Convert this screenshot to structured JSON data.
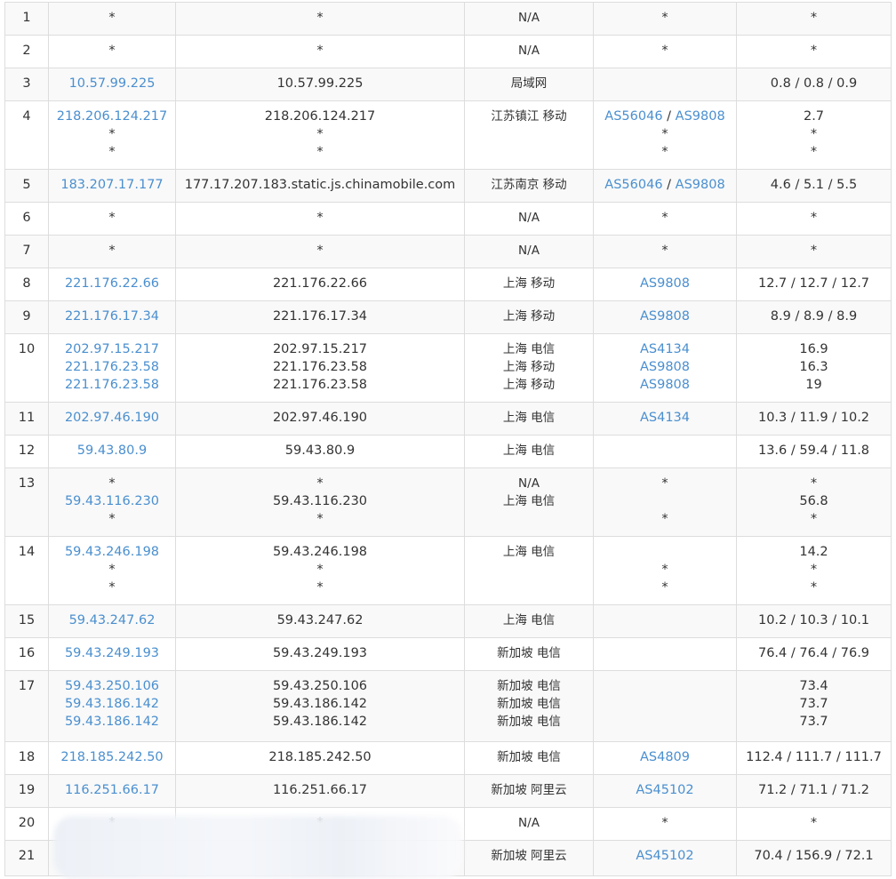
{
  "hops": [
    {
      "hop": "1",
      "ip": [
        "*"
      ],
      "host": [
        "*"
      ],
      "geo": [
        "N/A"
      ],
      "asn": [
        []
      ],
      "asn_star": [
        "*"
      ],
      "latency": [
        "*"
      ]
    },
    {
      "hop": "2",
      "ip": [
        "*"
      ],
      "host": [
        "*"
      ],
      "geo": [
        "N/A"
      ],
      "asn": [
        []
      ],
      "asn_star": [
        "*"
      ],
      "latency": [
        "*"
      ]
    },
    {
      "hop": "3",
      "ip": [
        "10.57.99.225"
      ],
      "host": [
        "10.57.99.225"
      ],
      "geo": [
        "局域网"
      ],
      "asn": [
        []
      ],
      "asn_star": [
        ""
      ],
      "latency": [
        "0.8 / 0.8 / 0.9"
      ]
    },
    {
      "hop": "4",
      "ip": [
        "218.206.124.217",
        "*",
        "*"
      ],
      "host": [
        "218.206.124.217",
        "*",
        "*"
      ],
      "geo": [
        "江苏镇江 移动",
        "",
        ""
      ],
      "asn": [
        [
          "AS56046",
          "AS9808"
        ],
        [],
        []
      ],
      "asn_star": [
        "",
        "*",
        "*"
      ],
      "latency": [
        "2.7",
        "*",
        "*"
      ]
    },
    {
      "hop": "5",
      "ip": [
        "183.207.17.177"
      ],
      "host": [
        "177.17.207.183.static.js.chinamobile.com"
      ],
      "geo": [
        "江苏南京 移动"
      ],
      "asn": [
        [
          "AS56046",
          "AS9808"
        ]
      ],
      "asn_star": [
        ""
      ],
      "latency": [
        "4.6 / 5.1 / 5.5"
      ]
    },
    {
      "hop": "6",
      "ip": [
        "*"
      ],
      "host": [
        "*"
      ],
      "geo": [
        "N/A"
      ],
      "asn": [
        []
      ],
      "asn_star": [
        "*"
      ],
      "latency": [
        "*"
      ]
    },
    {
      "hop": "7",
      "ip": [
        "*"
      ],
      "host": [
        "*"
      ],
      "geo": [
        "N/A"
      ],
      "asn": [
        []
      ],
      "asn_star": [
        "*"
      ],
      "latency": [
        "*"
      ]
    },
    {
      "hop": "8",
      "ip": [
        "221.176.22.66"
      ],
      "host": [
        "221.176.22.66"
      ],
      "geo": [
        "上海 移动"
      ],
      "asn": [
        [
          "AS9808"
        ]
      ],
      "asn_star": [
        ""
      ],
      "latency": [
        "12.7 / 12.7 / 12.7"
      ]
    },
    {
      "hop": "9",
      "ip": [
        "221.176.17.34"
      ],
      "host": [
        "221.176.17.34"
      ],
      "geo": [
        "上海 移动"
      ],
      "asn": [
        [
          "AS9808"
        ]
      ],
      "asn_star": [
        ""
      ],
      "latency": [
        "8.9 / 8.9 / 8.9"
      ]
    },
    {
      "hop": "10",
      "ip": [
        "202.97.15.217",
        "221.176.23.58",
        "221.176.23.58"
      ],
      "host": [
        "202.97.15.217",
        "221.176.23.58",
        "221.176.23.58"
      ],
      "geo": [
        "上海 电信",
        "上海 移动",
        "上海 移动"
      ],
      "asn": [
        [
          "AS4134"
        ],
        [
          "AS9808"
        ],
        [
          "AS9808"
        ]
      ],
      "asn_star": [
        "",
        "",
        ""
      ],
      "latency": [
        "16.9",
        "16.3",
        "19"
      ]
    },
    {
      "hop": "11",
      "ip": [
        "202.97.46.190"
      ],
      "host": [
        "202.97.46.190"
      ],
      "geo": [
        "上海 电信"
      ],
      "asn": [
        [
          "AS4134"
        ]
      ],
      "asn_star": [
        ""
      ],
      "latency": [
        "10.3 / 11.9 / 10.2"
      ]
    },
    {
      "hop": "12",
      "ip": [
        "59.43.80.9"
      ],
      "host": [
        "59.43.80.9"
      ],
      "geo": [
        "上海 电信"
      ],
      "asn": [
        []
      ],
      "asn_star": [
        ""
      ],
      "latency": [
        "13.6 / 59.4 / 11.8"
      ]
    },
    {
      "hop": "13",
      "ip": [
        "*",
        "59.43.116.230",
        "*"
      ],
      "host": [
        "*",
        "59.43.116.230",
        "*"
      ],
      "geo": [
        "N/A",
        "上海 电信",
        ""
      ],
      "asn": [
        [],
        [],
        []
      ],
      "asn_star": [
        "*",
        "",
        "*"
      ],
      "latency": [
        "*",
        "56.8",
        "*"
      ]
    },
    {
      "hop": "14",
      "ip": [
        "59.43.246.198",
        "*",
        "*"
      ],
      "host": [
        "59.43.246.198",
        "*",
        "*"
      ],
      "geo": [
        "上海 电信",
        "",
        ""
      ],
      "asn": [
        [],
        [],
        []
      ],
      "asn_star": [
        "",
        "*",
        "*"
      ],
      "latency": [
        "14.2",
        "*",
        "*"
      ]
    },
    {
      "hop": "15",
      "ip": [
        "59.43.247.62"
      ],
      "host": [
        "59.43.247.62"
      ],
      "geo": [
        "上海 电信"
      ],
      "asn": [
        []
      ],
      "asn_star": [
        ""
      ],
      "latency": [
        "10.2 / 10.3 / 10.1"
      ]
    },
    {
      "hop": "16",
      "ip": [
        "59.43.249.193"
      ],
      "host": [
        "59.43.249.193"
      ],
      "geo": [
        "新加坡 电信"
      ],
      "asn": [
        []
      ],
      "asn_star": [
        ""
      ],
      "latency": [
        "76.4 / 76.4 / 76.9"
      ]
    },
    {
      "hop": "17",
      "ip": [
        "59.43.250.106",
        "59.43.186.142",
        "59.43.186.142"
      ],
      "host": [
        "59.43.250.106",
        "59.43.186.142",
        "59.43.186.142"
      ],
      "geo": [
        "新加坡 电信",
        "新加坡 电信",
        "新加坡 电信"
      ],
      "asn": [
        [],
        [],
        []
      ],
      "asn_star": [
        "",
        "",
        ""
      ],
      "latency": [
        "73.4",
        "73.7",
        "73.7"
      ]
    },
    {
      "hop": "18",
      "ip": [
        "218.185.242.50"
      ],
      "host": [
        "218.185.242.50"
      ],
      "geo": [
        "新加坡 电信"
      ],
      "asn": [
        [
          "AS4809"
        ]
      ],
      "asn_star": [
        ""
      ],
      "latency": [
        "112.4 / 111.7 / 111.7"
      ]
    },
    {
      "hop": "19",
      "ip": [
        "116.251.66.17"
      ],
      "host": [
        "116.251.66.17"
      ],
      "geo": [
        "新加坡 阿里云"
      ],
      "asn": [
        [
          "AS45102"
        ]
      ],
      "asn_star": [
        ""
      ],
      "latency": [
        "71.2 / 71.1 / 71.2"
      ]
    },
    {
      "hop": "20",
      "ip": [
        "*"
      ],
      "host": [
        "*"
      ],
      "geo": [
        "N/A"
      ],
      "asn": [
        []
      ],
      "asn_star": [
        "*"
      ],
      "latency": [
        "*"
      ]
    },
    {
      "hop": "21",
      "ip": [
        ""
      ],
      "host": [
        ""
      ],
      "geo": [
        "新加坡 阿里云"
      ],
      "asn": [
        [
          "AS45102"
        ]
      ],
      "asn_star": [
        ""
      ],
      "latency": [
        "70.4 / 156.9 / 72.1"
      ]
    }
  ]
}
